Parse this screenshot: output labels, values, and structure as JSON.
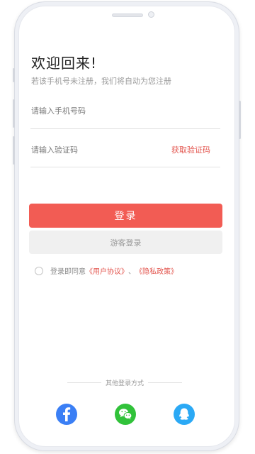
{
  "page": {
    "title": "欢迎回来!",
    "subtitle": "若该手机号未注册，我们将自动为您注册"
  },
  "form": {
    "phone_placeholder": "请输入手机号码",
    "code_placeholder": "请输入验证码",
    "get_code_label": "获取验证码"
  },
  "buttons": {
    "login_label": "登录",
    "guest_label": "游客登录"
  },
  "agreement": {
    "prefix": "登录即同意",
    "user_agreement": "《用户协议》",
    "separator": "、",
    "privacy_policy": "《隐私政策》"
  },
  "other_login": {
    "label": "其他登录方式",
    "methods": [
      {
        "icon": "facebook-icon"
      },
      {
        "icon": "wechat-icon"
      },
      {
        "icon": "qq-icon"
      }
    ]
  },
  "colors": {
    "accent": "#f25c54",
    "link": "#e3564f",
    "facebook": "#3b7ff5",
    "wechat": "#31c23a",
    "qq": "#2ba9f5"
  }
}
